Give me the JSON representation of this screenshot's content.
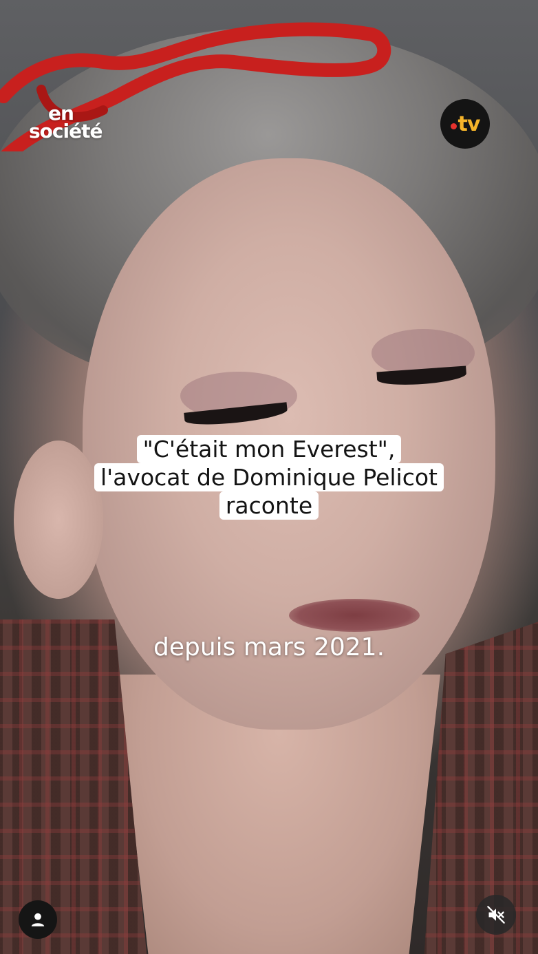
{
  "brand": {
    "line1": "en",
    "line2": "société"
  },
  "channel": {
    "logo_text": "tv",
    "dot_color": "#e6322d",
    "text_color": "#f5b42a"
  },
  "headline": {
    "line1": "\"C'était mon Everest\",",
    "line2": "l'avocat de Dominique Pelicot",
    "line3": "raconte"
  },
  "subtitle": {
    "text": "depuis mars 2021."
  },
  "controls": {
    "profile_icon": "user-icon",
    "mute_icon": "speaker-muted-icon"
  },
  "colors": {
    "caption_background": "#ffffff",
    "caption_text": "#141414",
    "glasses": "#c8201e"
  }
}
